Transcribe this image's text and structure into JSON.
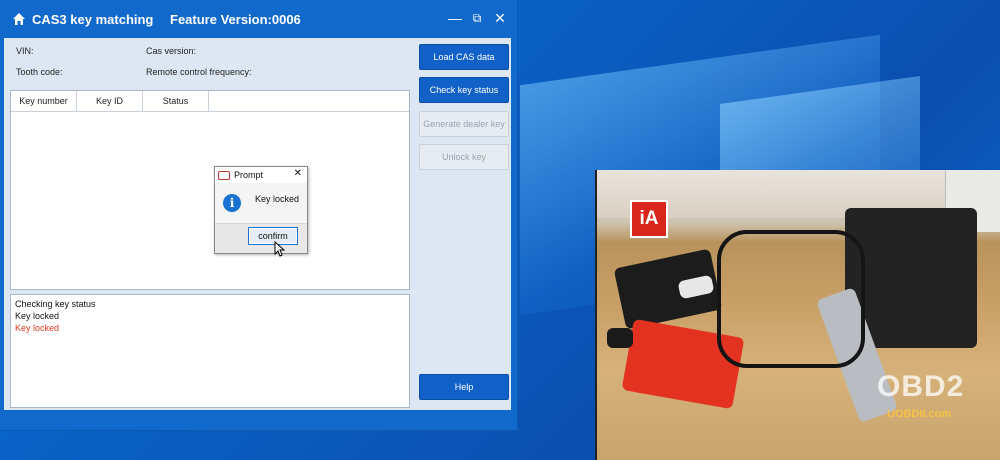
{
  "window": {
    "title": "CAS3 key matching",
    "feature_version": "Feature Version:0006",
    "controls": {
      "minimize": "—",
      "restore": "⧉",
      "close": "✕"
    }
  },
  "info": {
    "vin_label": "VIN:",
    "cas_version_label": "Cas version:",
    "tooth_code_label": "Tooth code:",
    "remote_freq_label": "Remote control frequency:"
  },
  "table": {
    "columns": [
      "Key number",
      "Key ID",
      "Status"
    ]
  },
  "log": [
    {
      "text": "Checking key status",
      "color": "#111111"
    },
    {
      "text": "Key locked",
      "color": "#111111"
    },
    {
      "text": "Key locked",
      "color": "#e03a1e"
    }
  ],
  "buttons": {
    "load_cas": "Load CAS data",
    "check_key": "Check key status",
    "generate_dealer": "Generate dealer key",
    "unlock_key": "Unlock key",
    "help": "Help"
  },
  "prompt": {
    "title": "Prompt",
    "message": "Key locked",
    "confirm": "confirm",
    "close": "✕",
    "info_glyph": "i"
  },
  "video": {
    "logo_text": "iA",
    "watermark": "OBD2",
    "watermark_sub": "UOBDII.com"
  },
  "colors": {
    "accent": "#1169cc",
    "error": "#e03a1e"
  }
}
